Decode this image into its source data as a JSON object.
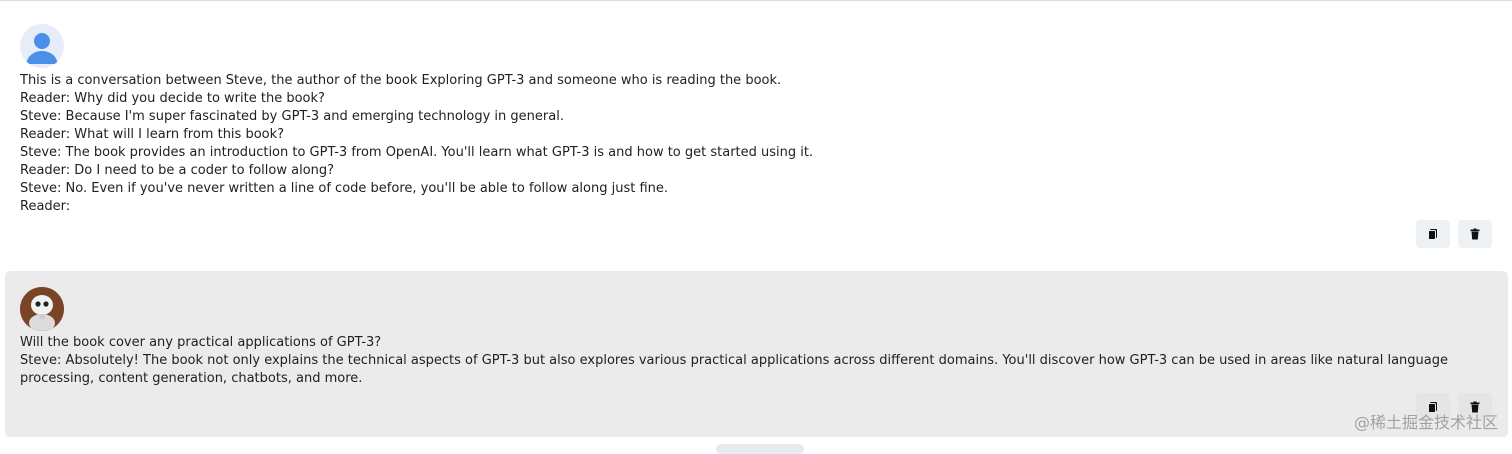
{
  "messages": [
    {
      "role": "user",
      "avatar_icon": "person-icon",
      "lines": [
        "This is a conversation between Steve, the author of the book Exploring GPT-3 and someone who is reading the book.",
        "Reader: Why did you decide to write the book?",
        "Steve: Because I'm super fascinated by GPT-3 and emerging technology in general.",
        "Reader: What will I learn from this book?",
        "Steve: The book provides an introduction to GPT-3 from OpenAI. You'll learn what GPT-3 is and how to get started using it.",
        "Reader: Do I need to be a coder to follow along?",
        "Steve: No. Even if you've never written a line of code before, you'll be able to follow along just fine.",
        "Reader:"
      ],
      "actions": {
        "copy_icon": "copy-icon",
        "delete_icon": "trash-icon"
      }
    },
    {
      "role": "assistant",
      "avatar_icon": "robot-avatar",
      "lines": [
        "Will the book cover any practical applications of GPT-3?",
        "Steve: Absolutely! The book not only explains the technical aspects of GPT-3 but also explores various practical applications across different domains. You'll discover how GPT-3 can be used in areas like natural language processing, content generation, chatbots, and more."
      ],
      "actions": {
        "copy_icon": "copy-icon",
        "delete_icon": "trash-icon"
      }
    }
  ],
  "watermark": "@稀土掘金技术社区",
  "colors": {
    "user_bg": "#ffffff",
    "assistant_bg": "#ebebeb",
    "avatar_blue": "#4a8fe8"
  }
}
